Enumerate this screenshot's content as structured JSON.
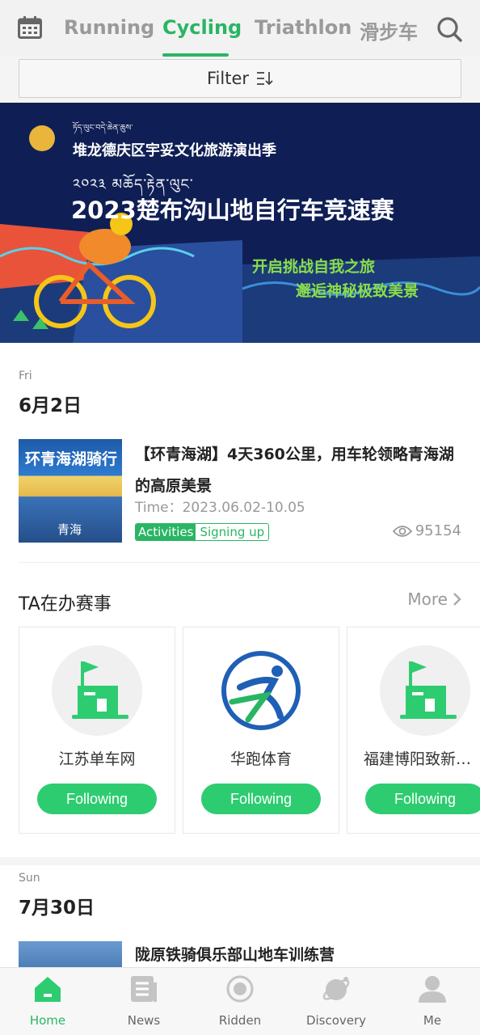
{
  "top_tabs": [
    "Running",
    "Cycling",
    "Triathlon",
    "滑步车"
  ],
  "active_tab": "Cycling",
  "filter_label": "Filter",
  "banner": {
    "tibetan_top": "ཏོད་ལུང་བདེ་ཆེན་ཆུས་",
    "subtitle": "堆龙德庆区宇妥文化旅游演出季",
    "tibetan_line": "༢༠༢༣ མཆོད་རྟེན་ལུང་",
    "title": "2023楚布沟山地自行车竞速赛",
    "slogan1": "开启挑战自我之旅",
    "slogan2": "邂逅神秘极致美景"
  },
  "sections": [
    {
      "day": "Fri",
      "date": "6月2日",
      "event": {
        "title": "【环青海湖】4天360公里，用车轮领略青海湖的高原美景",
        "time": "Time：2023.06.02-10.05",
        "badge_type": "Activities",
        "badge_status": "Signing up",
        "views": "95154",
        "thumb_title": "环青海湖骑行",
        "thumb_caption": "青海"
      }
    },
    {
      "day": "Sun",
      "date": "7月30日",
      "event": {
        "title": "陇原铁骑俱乐部山地车训练营"
      }
    }
  ],
  "organizers": {
    "title": "TA在办赛事",
    "more_label": "More",
    "items": [
      {
        "name": "江苏单车网",
        "button": "Following"
      },
      {
        "name": "华跑体育",
        "button": "Following"
      },
      {
        "name": "福建博阳致新…",
        "button": "Following"
      }
    ]
  },
  "bottom_nav": [
    {
      "label": "Home",
      "icon": "home-icon"
    },
    {
      "label": "News",
      "icon": "news-icon"
    },
    {
      "label": "Ridden",
      "icon": "ridden-icon"
    },
    {
      "label": "Discovery",
      "icon": "discovery-icon"
    },
    {
      "label": "Me",
      "icon": "me-icon"
    }
  ],
  "colors": {
    "accent": "#2ab564",
    "button": "#2ecc71",
    "banner_bg": "#0f1f55"
  }
}
